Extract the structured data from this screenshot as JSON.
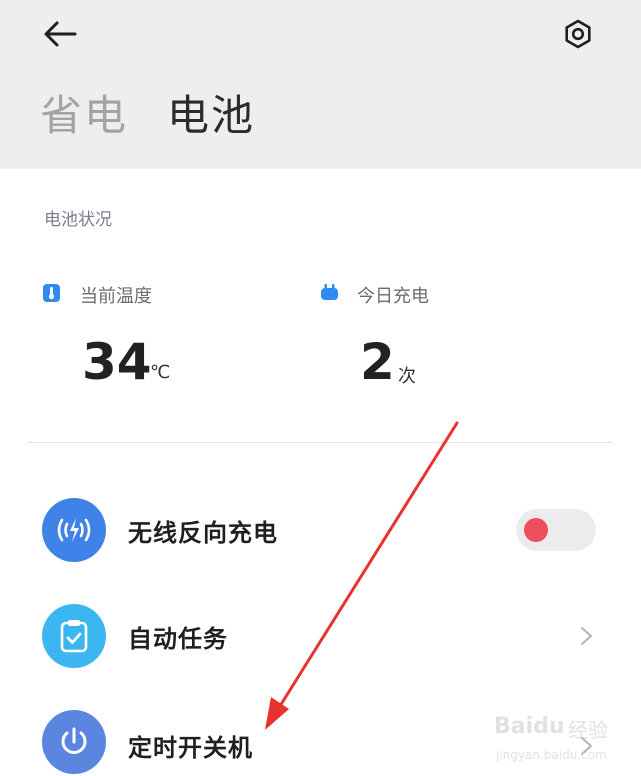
{
  "header": {
    "tabs": [
      {
        "label": "省电",
        "active": false
      },
      {
        "label": "电池",
        "active": true
      }
    ],
    "back_icon": "arrow-left-icon",
    "settings_icon": "gear-icon"
  },
  "battery_status": {
    "title": "电池状况",
    "stats": [
      {
        "label": "当前温度",
        "value": "34",
        "unit": "℃",
        "icon": "thermometer-icon"
      },
      {
        "label": "今日充电",
        "value": "2",
        "unit": "次",
        "icon": "plug-icon"
      }
    ]
  },
  "features": [
    {
      "label": "无线反向充电",
      "icon": "wireless-charging-icon",
      "color": "#3f82e8",
      "control": "toggle",
      "toggle_on": false
    },
    {
      "label": "自动任务",
      "icon": "clipboard-check-icon",
      "color": "#3cb6f0",
      "control": "chevron"
    },
    {
      "label": "定时开关机",
      "icon": "power-icon",
      "color": "#5b86e0",
      "control": "chevron"
    }
  ],
  "watermark": {
    "brand": "Baidu",
    "brand_cn": "经验",
    "url": "jingyan.baidu.com"
  },
  "colors": {
    "header_bg": "#edeef0",
    "accent_blue": "#2f8bf0",
    "toggle_knob": "#ec4e5e",
    "arrow": "#e8322f"
  }
}
